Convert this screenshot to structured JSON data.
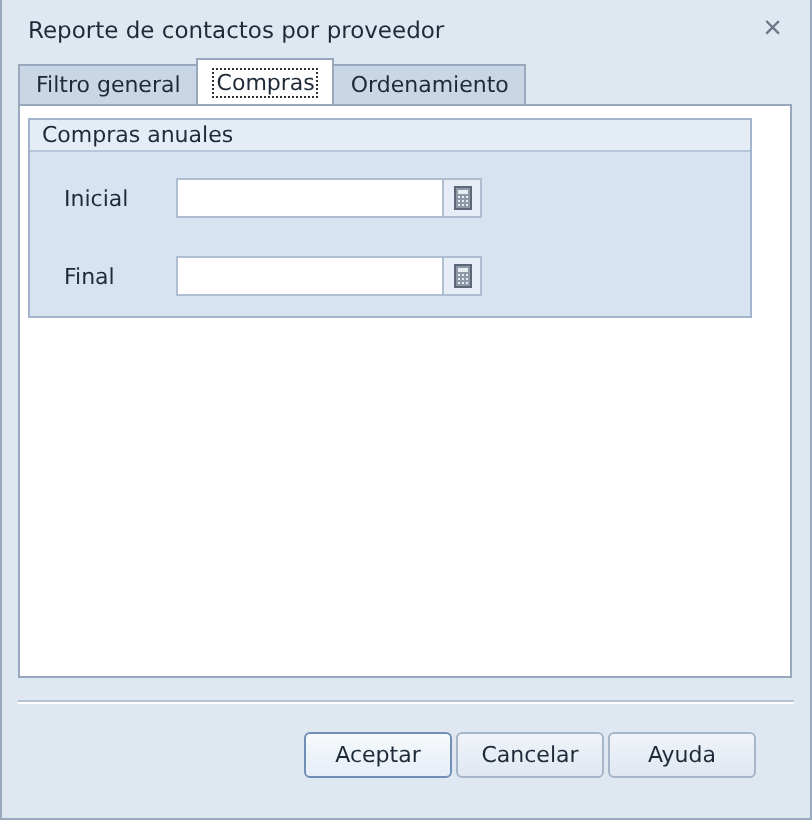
{
  "window": {
    "title": "Reporte de contactos por proveedor",
    "close": "×"
  },
  "tabs": [
    {
      "label": "Filtro general",
      "selected": false
    },
    {
      "label": "Compras",
      "selected": true
    },
    {
      "label": "Ordenamiento",
      "selected": false
    }
  ],
  "group": {
    "title": "Compras anuales",
    "fields": [
      {
        "label": "Inicial"
      },
      {
        "label": "Final"
      }
    ]
  },
  "buttons": [
    {
      "label": "Aceptar",
      "default": true
    },
    {
      "label": "Cancelar",
      "default": false
    },
    {
      "label": "Ayuda",
      "default": false
    }
  ]
}
